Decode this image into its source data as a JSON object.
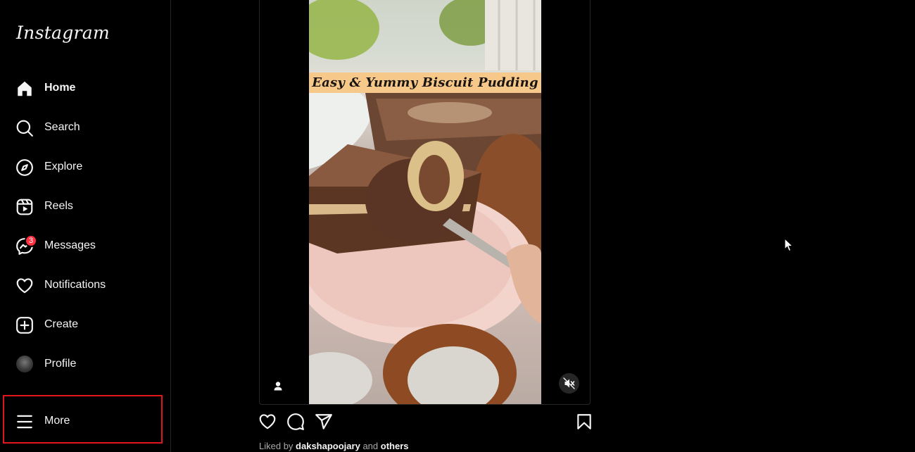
{
  "app": {
    "logo_text": "Instagram"
  },
  "sidebar": {
    "items": [
      {
        "label": "Home",
        "icon": "home-icon",
        "active": true
      },
      {
        "label": "Search",
        "icon": "search-icon"
      },
      {
        "label": "Explore",
        "icon": "compass-icon"
      },
      {
        "label": "Reels",
        "icon": "reels-icon"
      },
      {
        "label": "Messages",
        "icon": "messenger-icon",
        "badge": "3"
      },
      {
        "label": "Notifications",
        "icon": "heart-icon"
      },
      {
        "label": "Create",
        "icon": "plus-square-icon"
      },
      {
        "label": "Profile",
        "icon": "avatar"
      }
    ],
    "more": {
      "label": "More",
      "icon": "hamburger-menu-icon",
      "highlighted": true
    }
  },
  "post": {
    "overlay_title": "Easy & Yummy Biscuit Pudding",
    "tag_icon": "user-tag-icon",
    "mute_icon": "muted-speaker-icon",
    "actions": [
      "like-heart-icon",
      "comment-icon",
      "share-icon",
      "save-bookmark-icon"
    ],
    "likes": {
      "prefix": "Liked by",
      "user": "dakshapoojary",
      "conjunction": "and",
      "others": "others"
    }
  },
  "colors": {
    "background": "#000000",
    "text": "#f5f5f5",
    "badge": "#ff3040",
    "highlight_box": "#e0161c",
    "banner": "#f6c98b"
  }
}
